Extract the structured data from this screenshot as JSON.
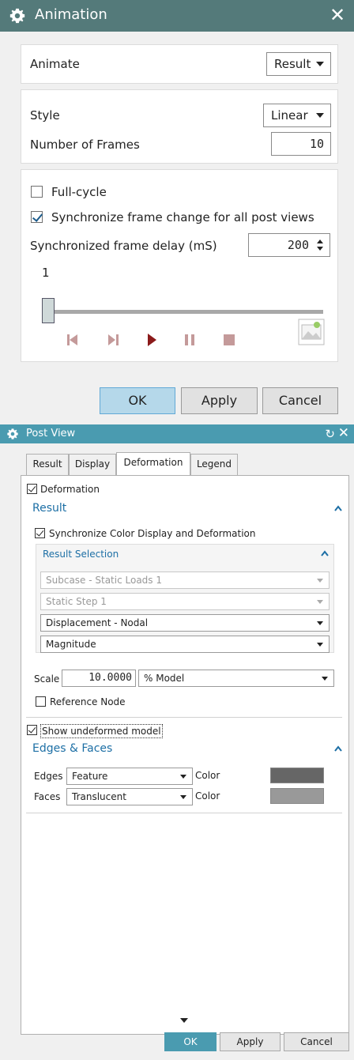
{
  "animation": {
    "title": "Animation",
    "animate": {
      "label": "Animate",
      "value": "Result"
    },
    "style": {
      "label": "Style",
      "value": "Linear"
    },
    "frames": {
      "label": "Number of Frames",
      "value": "10"
    },
    "full_cycle": {
      "label": "Full-cycle",
      "checked": false
    },
    "synchronize": {
      "label": "Synchronize frame change for all post views",
      "checked": true
    },
    "frame_delay": {
      "label": "Synchronized frame delay (mS)",
      "value": "200"
    },
    "slider": {
      "value_label": "1",
      "value": 1
    },
    "buttons": {
      "ok": "OK",
      "apply": "Apply",
      "cancel": "Cancel"
    }
  },
  "post_view": {
    "title": "Post View",
    "tabs": [
      "Result",
      "Display",
      "Deformation",
      "Legend"
    ],
    "active_tab": "Deformation",
    "deformation": {
      "label": "Deformation",
      "checked": true
    },
    "result_section": "Result",
    "sync_color": {
      "label": "Synchronize Color Display and Deformation",
      "checked": true
    },
    "result_selection": {
      "header": "Result Selection",
      "subcase": "Subcase - Static Loads 1",
      "step": "Static Step 1",
      "result_type": "Displacement - Nodal",
      "component": "Magnitude"
    },
    "scale": {
      "label": "Scale",
      "value": "10.0000",
      "unit": "% Model"
    },
    "reference_node": {
      "label": "Reference Node",
      "checked": false
    },
    "show_undeformed": {
      "label": "Show undeformed model",
      "checked": true
    },
    "edges_faces": {
      "header": "Edges & Faces",
      "edges": {
        "label": "Edges",
        "value": "Feature",
        "color_label": "Color",
        "color": "#666666"
      },
      "faces": {
        "label": "Faces",
        "value": "Translucent",
        "color_label": "Color",
        "color": "#999999"
      }
    },
    "buttons": {
      "ok": "OK",
      "apply": "Apply",
      "cancel": "Cancel"
    }
  },
  "colors": {
    "animation_titlebar": "#547a7a",
    "postview_titlebar": "#4a9bb0",
    "section_header": "#1d6fa5",
    "play_accent": "#8b1a1a",
    "playback_inactive": "#c49a9a"
  }
}
